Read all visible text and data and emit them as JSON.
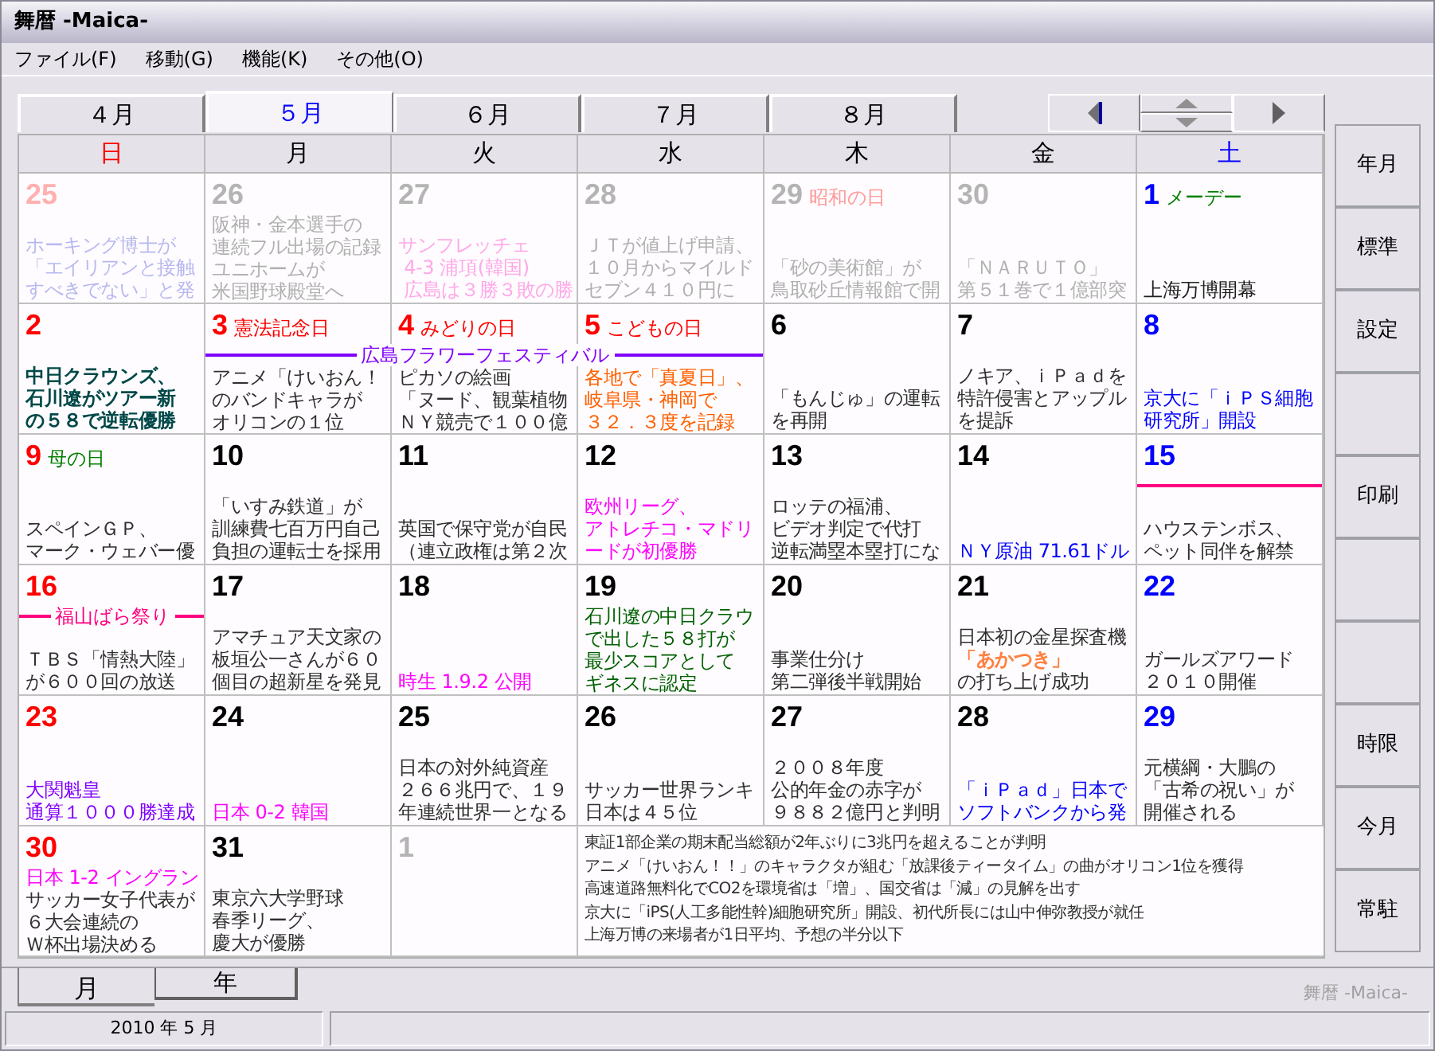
{
  "window": {
    "title": "舞暦 -Maica-"
  },
  "menu": [
    "ファイル(F)",
    "移動(G)",
    "機能(K)",
    "その他(O)"
  ],
  "month_tabs": [
    {
      "label": "４月",
      "selected": false
    },
    {
      "label": "５月",
      "selected": true
    },
    {
      "label": "６月",
      "selected": false
    },
    {
      "label": "７月",
      "selected": false
    },
    {
      "label": "８月",
      "selected": false
    }
  ],
  "weekdays": [
    "日",
    "月",
    "火",
    "水",
    "木",
    "金",
    "土"
  ],
  "weeks": [
    {
      "days": [
        {
          "day": "25",
          "muted": true,
          "notes": [
            {
              "text": "ホーキング博士が",
              "color": "#b8b8f0"
            },
            {
              "text": "「エイリアンと接触",
              "color": "#b8b8f0"
            },
            {
              "text": "すべきでない」と発",
              "color": "#b8b8f0"
            }
          ]
        },
        {
          "day": "26",
          "muted": true,
          "notes": [
            {
              "text": "阪神・金本選手の",
              "color": "#b0b0b0"
            },
            {
              "text": "連続フル出場の記録",
              "color": "#b0b0b0"
            },
            {
              "text": "ユニホームが",
              "color": "#b0b0b0"
            },
            {
              "text": "米国野球殿堂へ",
              "color": "#b0b0b0"
            }
          ]
        },
        {
          "day": "27",
          "muted": true,
          "notes": [
            {
              "text": "サンフレッチェ",
              "color": "#ffa8e8"
            },
            {
              "text": " 4-3 浦項(韓国)",
              "color": "#ffa8e8"
            },
            {
              "text": " 広島は３勝３敗の勝",
              "color": "#ffa8e8"
            }
          ]
        },
        {
          "day": "28",
          "muted": true,
          "notes": [
            {
              "text": "ＪＴが値上げ申請、",
              "color": "#b0b0b0"
            },
            {
              "text": "１０月からマイルド",
              "color": "#b0b0b0"
            },
            {
              "text": "セブン４１０円に",
              "color": "#b0b0b0"
            }
          ]
        },
        {
          "day": "29",
          "muted": true,
          "label": {
            "text": "昭和の日",
            "color": "#ff9a9a"
          },
          "notes": [
            {
              "text": "「砂の美術館」が",
              "color": "#b0b0b0"
            },
            {
              "text": "鳥取砂丘情報館で開",
              "color": "#b0b0b0"
            }
          ]
        },
        {
          "day": "30",
          "muted": true,
          "notes": [
            {
              "text": "「ＮＡＲＵＴＯ」",
              "color": "#b0b0b0"
            },
            {
              "text": "第５１巻で１億部突",
              "color": "#b0b0b0"
            }
          ]
        },
        {
          "day": "1",
          "muted": false,
          "label": {
            "text": "メーデー",
            "color": "#008000"
          },
          "notes": [
            {
              "text": "上海万博開幕",
              "color": "#202020"
            }
          ]
        }
      ]
    },
    {
      "event": {
        "label": "広島フラワーフェスティバル",
        "color": "#8000ff"
      },
      "days": [
        {
          "day": "2",
          "muted": false,
          "notes": [
            {
              "text": "中日クラウンズ、",
              "color": "#004848",
              "bold": true
            },
            {
              "text": "石川遼がツアー新",
              "color": "#004848",
              "bold": true
            },
            {
              "text": "の５８で逆転優勝",
              "color": "#004848",
              "bold": true
            }
          ]
        },
        {
          "day": "3",
          "muted": false,
          "in_event": true,
          "holiday": true,
          "label": {
            "text": "憲法記念日",
            "color": "#ff0000"
          },
          "notes": [
            {
              "text": "アニメ「けいおん！",
              "color": "#303030"
            },
            {
              "text": "のバンドキャラが",
              "color": "#303030"
            },
            {
              "text": "オリコンの１位",
              "color": "#303030"
            }
          ]
        },
        {
          "day": "4",
          "muted": false,
          "in_event": true,
          "holiday": true,
          "label": {
            "text": "みどりの日",
            "color": "#ff0000"
          },
          "notes": [
            {
              "text": "ピカソの絵画",
              "color": "#303030"
            },
            {
              "text": "「ヌード、観葉植物",
              "color": "#303030"
            },
            {
              "text": "ＮＹ競売で１００億",
              "color": "#303030"
            }
          ]
        },
        {
          "day": "5",
          "muted": false,
          "in_event": true,
          "holiday": true,
          "label": {
            "text": "こどもの日",
            "color": "#ff0000"
          },
          "notes": [
            {
              "text": "各地で「真夏日」、",
              "color": "#ff6000"
            },
            {
              "text": "岐阜県・神岡で",
              "color": "#ff6000"
            },
            {
              "text": "３２．３度を記録",
              "color": "#ff6000"
            }
          ]
        },
        {
          "day": "6",
          "muted": false,
          "notes": [
            {
              "text": "「もんじゅ」の運転",
              "color": "#303030"
            },
            {
              "text": "を再開",
              "color": "#303030"
            }
          ]
        },
        {
          "day": "7",
          "muted": false,
          "notes": [
            {
              "text": "ノキア、ｉＰａｄを",
              "color": "#303030"
            },
            {
              "text": "特許侵害とアップル",
              "color": "#303030"
            },
            {
              "text": "を提訴",
              "color": "#303030"
            }
          ]
        },
        {
          "day": "8",
          "muted": false,
          "notes": [
            {
              "text": "京大に「ｉＰＳ細胞",
              "color": "#0000ff"
            },
            {
              "text": "研究所」開設",
              "color": "#0000ff"
            }
          ]
        }
      ]
    },
    {
      "event": {
        "color": "#ff0080"
      },
      "days": [
        {
          "day": "9",
          "muted": false,
          "label": {
            "text": "母の日",
            "color": "#008000"
          },
          "notes": [
            {
              "text": "スペインＧＰ、",
              "color": "#303030"
            },
            {
              "text": "マーク・ウェバー優",
              "color": "#303030"
            }
          ]
        },
        {
          "day": "10",
          "muted": false,
          "notes": [
            {
              "text": "「いすみ鉄道」が",
              "color": "#303030"
            },
            {
              "text": "訓練費七百万円自己",
              "color": "#303030"
            },
            {
              "text": "負担の運転士を採用",
              "color": "#303030"
            }
          ]
        },
        {
          "day": "11",
          "muted": false,
          "notes": [
            {
              "text": "英国で保守党が自民",
              "color": "#303030"
            },
            {
              "text": "（連立政権は第２次",
              "color": "#303030"
            }
          ]
        },
        {
          "day": "12",
          "muted": false,
          "notes": [
            {
              "text": "欧州リーグ、",
              "color": "#ff00ff"
            },
            {
              "text": "アトレチコ・マドリ",
              "color": "#ff00ff"
            },
            {
              "text": "ードが初優勝",
              "color": "#ff00ff"
            }
          ]
        },
        {
          "day": "13",
          "muted": false,
          "notes": [
            {
              "text": "ロッテの福浦、",
              "color": "#303030"
            },
            {
              "text": "ビデオ判定で代打",
              "color": "#303030"
            },
            {
              "text": "逆転満塁本塁打にな",
              "color": "#303030"
            }
          ]
        },
        {
          "day": "14",
          "muted": false,
          "notes": [
            {
              "text": "ＮＹ原油 71.61ドル",
              "color": "#0000ff"
            }
          ]
        },
        {
          "day": "15",
          "muted": false,
          "in_event": true,
          "notes": [
            {
              "text": "ハウステンボス、",
              "color": "#303030"
            },
            {
              "text": "ペット同伴を解禁",
              "color": "#303030"
            }
          ]
        }
      ]
    },
    {
      "event": {
        "label": "福山ばら祭り",
        "color": "#ff0080"
      },
      "days": [
        {
          "day": "16",
          "muted": false,
          "in_event": true,
          "notes": [
            {
              "text": "ＴＢＳ「情熱大陸」",
              "color": "#303030"
            },
            {
              "text": "が６００回の放送",
              "color": "#303030"
            }
          ]
        },
        {
          "day": "17",
          "muted": false,
          "notes": [
            {
              "text": "アマチュア天文家の",
              "color": "#303030"
            },
            {
              "text": "板垣公一さんが６０",
              "color": "#303030"
            },
            {
              "text": "個目の超新星を発見",
              "color": "#303030"
            }
          ]
        },
        {
          "day": "18",
          "muted": false,
          "notes": [
            {
              "text": "時生 1.9.2 公開",
              "color": "#ff00ff"
            }
          ]
        },
        {
          "day": "19",
          "muted": false,
          "notes": [
            {
              "text": "石川遼の中日クラウ",
              "color": "#006000"
            },
            {
              "text": "で出した５８打が",
              "color": "#006000"
            },
            {
              "text": "最少スコアとして",
              "color": "#006000"
            },
            {
              "text": "ギネスに認定",
              "color": "#006000"
            }
          ]
        },
        {
          "day": "20",
          "muted": false,
          "notes": [
            {
              "text": "事業仕分け",
              "color": "#303030"
            },
            {
              "text": "第二弾後半戦開始",
              "color": "#303030"
            }
          ]
        },
        {
          "day": "21",
          "muted": false,
          "notes": [
            {
              "text": "日本初の金星探査機",
              "color": "#303030"
            },
            {
              "text": "「あかつき」",
              "color": "#ff8040",
              "bold": true
            },
            {
              "text": "の打ち上げ成功",
              "color": "#303030"
            }
          ]
        },
        {
          "day": "22",
          "muted": false,
          "notes": [
            {
              "text": "ガールズアワード",
              "color": "#303030"
            },
            {
              "text": "２０１０開催",
              "color": "#303030"
            }
          ]
        }
      ]
    },
    {
      "days": [
        {
          "day": "23",
          "muted": false,
          "notes": [
            {
              "text": "大関魁皇",
              "color": "#8000ff"
            },
            {
              "text": "通算１０００勝達成",
              "color": "#8000ff"
            }
          ]
        },
        {
          "day": "24",
          "muted": false,
          "notes": [
            {
              "text": "日本 0-2 韓国",
              "color": "#ff00ff"
            }
          ]
        },
        {
          "day": "25",
          "muted": false,
          "notes": [
            {
              "text": "日本の対外純資産",
              "color": "#303030"
            },
            {
              "text": "２６６兆円で、１９",
              "color": "#303030"
            },
            {
              "text": "年連続世界一となる",
              "color": "#303030"
            }
          ]
        },
        {
          "day": "26",
          "muted": false,
          "notes": [
            {
              "text": "サッカー世界ランキ",
              "color": "#303030"
            },
            {
              "text": "日本は４５位",
              "color": "#303030"
            }
          ]
        },
        {
          "day": "27",
          "muted": false,
          "notes": [
            {
              "text": "２００８年度",
              "color": "#303030"
            },
            {
              "text": "公的年金の赤字が",
              "color": "#303030"
            },
            {
              "text": "９８８２億円と判明",
              "color": "#303030"
            }
          ]
        },
        {
          "day": "28",
          "muted": false,
          "notes": [
            {
              "text": "「ｉＰａｄ」日本で",
              "color": "#0000ff"
            },
            {
              "text": "ソフトバンクから発",
              "color": "#0000ff"
            }
          ]
        },
        {
          "day": "29",
          "muted": false,
          "notes": [
            {
              "text": "元横綱・大鵬の",
              "color": "#303030"
            },
            {
              "text": "「古希の祝い」が",
              "color": "#303030"
            },
            {
              "text": "開催される",
              "color": "#303030"
            }
          ]
        }
      ]
    },
    {
      "days": [
        {
          "day": "30",
          "muted": false,
          "notes": [
            {
              "text": "日本 1-2 イングラン",
              "color": "#ff00ff"
            },
            {
              "text": "サッカー女子代表が",
              "color": "#303030"
            },
            {
              "text": "６大会連続の",
              "color": "#303030"
            },
            {
              "text": "Ｗ杯出場決める",
              "color": "#303030"
            }
          ]
        },
        {
          "day": "31",
          "muted": false,
          "notes": [
            {
              "text": "東京六大学野球",
              "color": "#303030"
            },
            {
              "text": "春季リーグ、",
              "color": "#303030"
            },
            {
              "text": "慶大が優勝",
              "color": "#303030"
            }
          ]
        },
        {
          "day": "1",
          "muted": true
        }
      ]
    }
  ],
  "memo": [
    "東証1部企業の期末配当総額が2年ぶりに3兆円を超えることが判明",
    "アニメ「けいおん！！」のキャラクタが組む「放課後ティータイム」の曲がオリコン1位を獲得",
    "高速道路無料化でCO2を環境省は「増」、国交省は「減」の見解を出す",
    "京大に「iPS(人工多能性幹)細胞研究所」開設、初代所長には山中伸弥教授が就任",
    "上海万博の来場者が1日平均、予想の半分以下"
  ],
  "side_buttons": [
    {
      "kind": "label",
      "label": "年月"
    },
    {
      "kind": "label",
      "label": "標準"
    },
    {
      "kind": "label",
      "label": "設定"
    },
    {
      "kind": "blank"
    },
    {
      "kind": "label",
      "label": "印刷"
    },
    {
      "kind": "blank"
    },
    {
      "kind": "blank"
    },
    {
      "kind": "label",
      "label": "時限"
    },
    {
      "kind": "label",
      "label": "今月"
    },
    {
      "kind": "label",
      "label": "常駐"
    }
  ],
  "view_tabs": [
    {
      "label": "月",
      "selected": true
    },
    {
      "label": "年",
      "selected": false
    }
  ],
  "footer_brand": "舞暦 -Maica-",
  "status_bar": {
    "date": "2010 年 5 月"
  }
}
